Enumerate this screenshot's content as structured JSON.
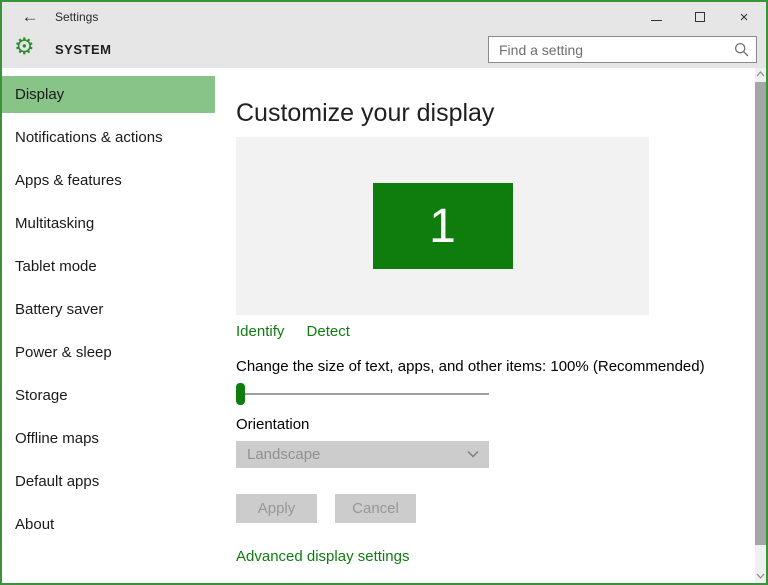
{
  "colors": {
    "accent_green": "#0e7d0e",
    "window_border_green": "#3a923a",
    "sidebar_selected_bg": "#88c388",
    "topbar_bg": "#e6e6e6",
    "preview_bg": "#f2f2f2",
    "disabled_control_bg": "#cccccc",
    "disabled_text": "#979797",
    "link_green": "#107c10"
  },
  "titlebar": {
    "title": "Settings",
    "back_glyph": "←",
    "close_glyph": "×"
  },
  "header": {
    "section_title": "SYSTEM",
    "search_placeholder": "Find a setting"
  },
  "sidebar": {
    "items": [
      {
        "label": "Display",
        "selected": true
      },
      {
        "label": "Notifications & actions",
        "selected": false
      },
      {
        "label": "Apps & features",
        "selected": false
      },
      {
        "label": "Multitasking",
        "selected": false
      },
      {
        "label": "Tablet mode",
        "selected": false
      },
      {
        "label": "Battery saver",
        "selected": false
      },
      {
        "label": "Power & sleep",
        "selected": false
      },
      {
        "label": "Storage",
        "selected": false
      },
      {
        "label": "Offline maps",
        "selected": false
      },
      {
        "label": "Default apps",
        "selected": false
      },
      {
        "label": "About",
        "selected": false
      }
    ]
  },
  "main": {
    "heading": "Customize your display",
    "preview": {
      "monitor_label": "1"
    },
    "identify_link": "Identify",
    "detect_link": "Detect",
    "scale_label": "Change the size of text, apps, and other items: 100% (Recommended)",
    "slider": {
      "value": "100% (Recommended)",
      "position_percent": 0
    },
    "orientation_label": "Orientation",
    "orientation_value": "Landscape",
    "apply_button": "Apply",
    "cancel_button": "Cancel",
    "advanced_link": "Advanced display settings"
  }
}
